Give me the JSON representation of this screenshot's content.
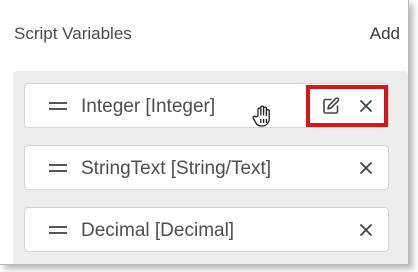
{
  "header": {
    "title": "Script Variables",
    "add_label": "Add"
  },
  "variables": [
    {
      "label": "Integer [Integer]",
      "actions": [
        "edit-icon",
        "close-icon"
      ]
    },
    {
      "label": "StringText [String/Text]",
      "actions": [
        "close-icon"
      ]
    },
    {
      "label": "Decimal [Decimal]",
      "actions": [
        "close-icon"
      ]
    }
  ],
  "colors": {
    "highlight": "#d6161d",
    "list_background": "#ededed",
    "text": "#4e4e4e"
  },
  "cursor": "hand-pointer-icon"
}
